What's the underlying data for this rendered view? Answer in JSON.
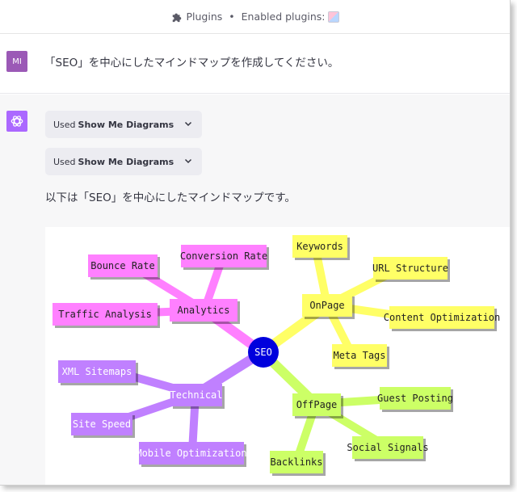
{
  "header": {
    "plugins_label": "Plugins",
    "separator": "•",
    "enabled_label": "Enabled plugins:"
  },
  "user_message": {
    "avatar": "MI",
    "text": "「SEO」を中心にしたマインドマップを作成してください。"
  },
  "assistant": {
    "tools": [
      {
        "prefix": "Used",
        "name": "Show Me Diagrams"
      },
      {
        "prefix": "Used",
        "name": "Show Me Diagrams"
      }
    ],
    "text": "以下は「SEO」を中心にしたマインドマップです。"
  },
  "mindmap": {
    "center": "SEO",
    "colors": {
      "pink": "#ff80ff",
      "yellow": "#ffff66",
      "green": "#ccff66",
      "purple": "#c080ff",
      "center": "#0000dd"
    },
    "branches": {
      "analytics": {
        "label": "Analytics",
        "children": [
          "Bounce Rate",
          "Conversion Rate",
          "Traffic Analysis"
        ]
      },
      "onpage": {
        "label": "OnPage",
        "children": [
          "Keywords",
          "URL Structure",
          "Content Optimization",
          "Meta Tags"
        ]
      },
      "technical": {
        "label": "Technical",
        "children": [
          "XML Sitemaps",
          "Site Speed",
          "Mobile Optimization"
        ]
      },
      "offpage": {
        "label": "OffPage",
        "children": [
          "Guest Posting",
          "Social Signals",
          "Backlinks"
        ]
      }
    }
  }
}
